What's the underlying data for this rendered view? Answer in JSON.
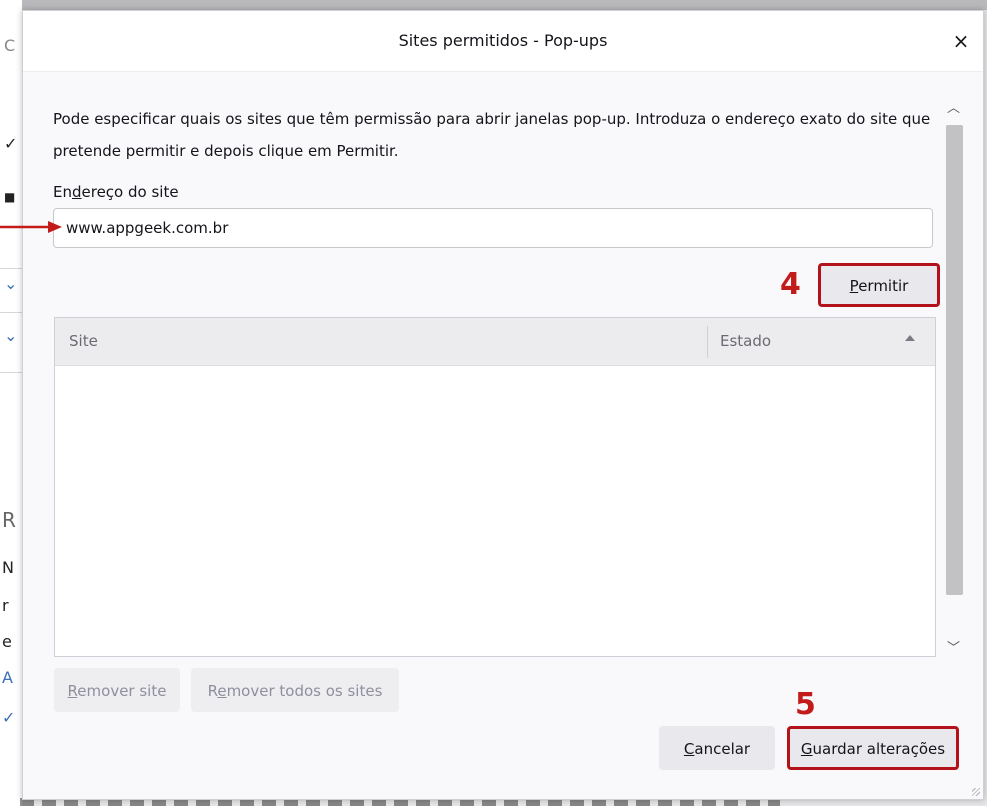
{
  "background": {
    "glyphs": [
      "C",
      "✓",
      "■",
      "⌄",
      "⌄",
      "R",
      "N",
      "r",
      "e",
      "A",
      "✓"
    ]
  },
  "dialog": {
    "title": "Sites permitidos - Pop-ups",
    "close_label": "×",
    "description": "Pode especificar quais os sites que têm permissão para abrir janelas pop-up. Introduza o endereço exato do site que pretende permitir e depois clique em Permitir.",
    "address_label_pre": "En",
    "address_label_acc": "d",
    "address_label_post": "ereço do site",
    "address_value": "www.appgeek.com.br",
    "permit_button_acc": "P",
    "permit_button_rest": "ermitir",
    "step_4": "4",
    "step_5": "5",
    "table": {
      "col_site": "Site",
      "col_status": "Estado",
      "rows": []
    },
    "remove_site_acc": "R",
    "remove_site_rest": "emover site",
    "remove_all_pre": "R",
    "remove_all_acc": "e",
    "remove_all_rest": "mover todos os sites",
    "cancel_acc": "C",
    "cancel_rest": "ancelar",
    "save_acc": "G",
    "save_rest": "uardar alterações"
  },
  "colors": {
    "highlight": "#b3121a",
    "step_number": "#c31a1a",
    "arrow": "#c31a1a"
  }
}
